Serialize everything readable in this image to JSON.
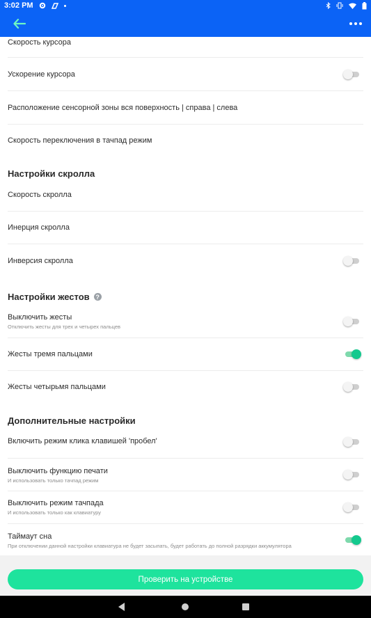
{
  "status_bar": {
    "time": "3:02 PM",
    "icons_left": [
      "gear-icon",
      "nfc-icon",
      "dot-icon"
    ],
    "icons_right": [
      "bluetooth-icon",
      "vibrate-icon",
      "wifi-icon",
      "battery-icon"
    ]
  },
  "app_bar": {
    "back_icon": "arrow-left-icon",
    "menu_icon": "more-dots-icon"
  },
  "settings": {
    "cursor_speed": "Скорость курсора",
    "cursor_accel": "Ускорение курсора",
    "touch_zone": "Расположение сенсорной зоны вся поверхность | справа | слева",
    "touchpad_switch_speed": "Скорость переключения в тачпад режим"
  },
  "scroll_section": {
    "title": "Настройки скролла",
    "speed": "Скорость скролла",
    "inertia": "Инерция скролла",
    "inversion": "Инверсия скролла"
  },
  "gesture_section": {
    "title": "Настройки жестов",
    "help_icon": "?",
    "disable_gestures": "Выключить жесты",
    "disable_gestures_sub": "Отключить жесты для трех и четырех пальцев",
    "three_finger": "Жесты тремя пальцами",
    "four_finger": "Жесты четырьмя пальцами"
  },
  "extra_section": {
    "title": "Дополнительные настройки",
    "space_click": "Включить режим клика клавишей 'пробел'",
    "disable_print": "Выключить функцию печати",
    "disable_print_sub": "И использовать только тачпад режим",
    "disable_touchpad": "Выключить режим тачпада",
    "disable_touchpad_sub": "И использовать только как клавиатуру",
    "sleep_timeout": "Таймаут сна",
    "sleep_timeout_sub": "При отключении данной настройки клавиатура не будет засыпать, будет работать до полной разрядки аккумулятора"
  },
  "toggles": {
    "cursor_accel": false,
    "scroll_inversion": false,
    "disable_gestures": false,
    "three_finger": true,
    "four_finger": false,
    "space_click": false,
    "disable_print": false,
    "disable_touchpad": false,
    "sleep_timeout": true
  },
  "check_button": "Проверить на устройстве",
  "colors": {
    "primary": "#0b63f6",
    "accent": "#1ee39d",
    "toggle_on": "#14c98e"
  }
}
